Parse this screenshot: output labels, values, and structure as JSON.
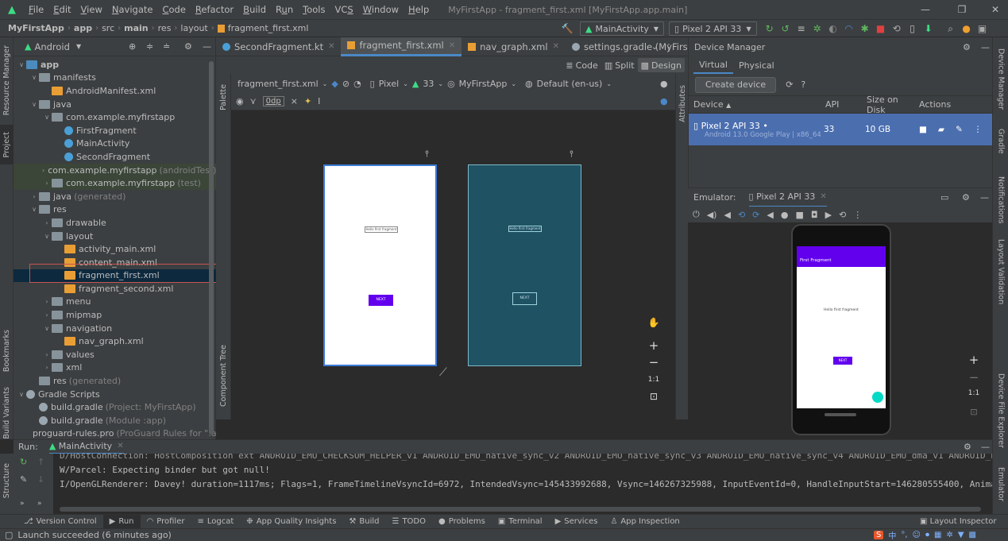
{
  "menubar": {
    "items": [
      "File",
      "Edit",
      "View",
      "Navigate",
      "Code",
      "Refactor",
      "Build",
      "Run",
      "Tools",
      "VCS",
      "Window",
      "Help"
    ],
    "mnemonics": [
      "F",
      "E",
      "V",
      "N",
      "C",
      "R",
      "B",
      "u",
      "T",
      "S",
      "W",
      "H"
    ],
    "window_title": "MyFirstApp - fragment_first.xml [MyFirstApp.app.main]"
  },
  "navbar": {
    "breadcrumbs": [
      "MyFirstApp",
      "app",
      "src",
      "main",
      "res",
      "layout",
      "fragment_first.xml"
    ],
    "run_config": "MainActivity",
    "device": "Pixel 2 API 33"
  },
  "left_strip": {
    "tabs": [
      "Resource Manager",
      "Project",
      "Bookmarks",
      "Build Variants",
      "Structure"
    ]
  },
  "project": {
    "view_selector": "Android",
    "tree": [
      {
        "label": "app",
        "depth": 0,
        "arrow": "v",
        "icon": "mod"
      },
      {
        "label": "manifests",
        "depth": 1,
        "arrow": "v",
        "icon": "folder"
      },
      {
        "label": "AndroidManifest.xml",
        "depth": 2,
        "arrow": "",
        "icon": "xml"
      },
      {
        "label": "java",
        "depth": 1,
        "arrow": "v",
        "icon": "folder"
      },
      {
        "label": "com.example.myfirstapp",
        "depth": 2,
        "arrow": "v",
        "icon": "pkg"
      },
      {
        "label": "FirstFragment",
        "depth": 3,
        "arrow": "",
        "icon": "kt"
      },
      {
        "label": "MainActivity",
        "depth": 3,
        "arrow": "",
        "icon": "kt"
      },
      {
        "label": "SecondFragment",
        "depth": 3,
        "arrow": "",
        "icon": "kt"
      },
      {
        "label": "com.example.myfirstapp",
        "depth": 2,
        "arrow": ">",
        "icon": "pkg",
        "note": "(androidTest)",
        "test": true
      },
      {
        "label": "com.example.myfirstapp",
        "depth": 2,
        "arrow": ">",
        "icon": "pkg",
        "note": "(test)",
        "test": true
      },
      {
        "label": "java",
        "depth": 1,
        "arrow": ">",
        "icon": "folder",
        "note": "(generated)"
      },
      {
        "label": "res",
        "depth": 1,
        "arrow": "v",
        "icon": "res"
      },
      {
        "label": "drawable",
        "depth": 2,
        "arrow": ">",
        "icon": "folder"
      },
      {
        "label": "layout",
        "depth": 2,
        "arrow": "v",
        "icon": "folder"
      },
      {
        "label": "activity_main.xml",
        "depth": 3,
        "arrow": "",
        "icon": "xml"
      },
      {
        "label": "content_main.xml",
        "depth": 3,
        "arrow": "",
        "icon": "xml"
      },
      {
        "label": "fragment_first.xml",
        "depth": 3,
        "arrow": "",
        "icon": "xml",
        "selected": true
      },
      {
        "label": "fragment_second.xml",
        "depth": 3,
        "arrow": "",
        "icon": "xml"
      },
      {
        "label": "menu",
        "depth": 2,
        "arrow": ">",
        "icon": "folder"
      },
      {
        "label": "mipmap",
        "depth": 2,
        "arrow": ">",
        "icon": "folder"
      },
      {
        "label": "navigation",
        "depth": 2,
        "arrow": "v",
        "icon": "folder"
      },
      {
        "label": "nav_graph.xml",
        "depth": 3,
        "arrow": "",
        "icon": "xml"
      },
      {
        "label": "values",
        "depth": 2,
        "arrow": ">",
        "icon": "folder"
      },
      {
        "label": "xml",
        "depth": 2,
        "arrow": ">",
        "icon": "folder"
      },
      {
        "label": "res",
        "depth": 1,
        "arrow": "",
        "icon": "res",
        "note": "(generated)"
      },
      {
        "label": "Gradle Scripts",
        "depth": 0,
        "arrow": "v",
        "icon": "gradle"
      },
      {
        "label": "build.gradle",
        "depth": 1,
        "arrow": "",
        "icon": "gradle",
        "note": "(Project: MyFirstApp)"
      },
      {
        "label": "build.gradle",
        "depth": 1,
        "arrow": "",
        "icon": "gradle",
        "note": "(Module :app)"
      },
      {
        "label": "proguard-rules.pro",
        "depth": 1,
        "arrow": "",
        "icon": "gradle",
        "note": "(ProGuard Rules for \":a"
      }
    ]
  },
  "tabs": [
    {
      "label": "SecondFragment.kt",
      "icon": "kt",
      "active": false
    },
    {
      "label": "fragment_first.xml",
      "icon": "xml",
      "active": true
    },
    {
      "label": "nav_graph.xml",
      "icon": "xml",
      "active": false
    },
    {
      "label": "settings.gradle (MyFirstApp)",
      "icon": "gradle",
      "active": false
    }
  ],
  "design_modes": {
    "code": "Code",
    "split": "Split",
    "design": "Design"
  },
  "palette_label": "Palette",
  "component_tree_label": "Component Tree",
  "attributes_label": "Attributes",
  "layout_toolbar": {
    "file": "fragment_first.xml",
    "device": "Pixel",
    "api": "33",
    "theme": "MyFirstApp",
    "locale": "Default (en-us)",
    "margin": "0dp"
  },
  "design_preview": {
    "hello_text": "Hello first fragment",
    "next_label": "NEXT"
  },
  "zoom_controls": {
    "fit": "1:1"
  },
  "device_manager": {
    "title": "Device Manager",
    "tabs": [
      "Virtual",
      "Physical"
    ],
    "create_button": "Create device",
    "columns": [
      "Device",
      "API",
      "Size on Disk",
      "Actions"
    ],
    "devices": [
      {
        "name": "Pixel 2 API 33",
        "status": "•",
        "subtitle": "Android 13.0 Google Play | x86_64",
        "api": "33",
        "size": "10 GB"
      }
    ]
  },
  "emulator": {
    "label": "Emulator:",
    "tab": "Pixel 2 API 33",
    "screen_title": "First Fragment",
    "screen_text": "Hello first fragment",
    "screen_button": "NEXT"
  },
  "right_strip": {
    "tabs": [
      "Device Manager",
      "Gradle",
      "Notifications",
      "Layout Validation",
      "Device File Explorer",
      "Emulator"
    ]
  },
  "run": {
    "label": "Run:",
    "config": "MainActivity",
    "lines": [
      "D/HostConnection: HostComposition ext ANDROID_EMU_CHECKSUM_HELPER_v1 ANDROID_EMU_native_sync_v2 ANDROID_EMU_native_sync_v3 ANDROID_EMU_native_sync_v4 ANDROID_EMU_dma_v1 ANDROID_E",
      "W/Parcel: Expecting binder but got null!",
      "I/OpenGLRenderer: Davey! duration=1117ms; Flags=1, FrameTimelineVsyncId=6972, IntendedVsync=145433992688, Vsync=146267325988, InputEventId=0, HandleInputStart=146280555400, Anima"
    ]
  },
  "bottom_tools": [
    "Version Control",
    "Run",
    "Profiler",
    "Logcat",
    "App Quality Insights",
    "Build",
    "TODO",
    "Problems",
    "Terminal",
    "Services",
    "App Inspection"
  ],
  "layout_inspector": "Layout Inspector",
  "status": {
    "message": "Launch succeeded (6 minutes ago)"
  },
  "ime": {
    "label": "中"
  },
  "colors": {
    "accent": "#4a88c7",
    "selection": "#4b6eaf",
    "android": "#3ddc84",
    "purple": "#6200ee",
    "xml": "#e89e35"
  }
}
